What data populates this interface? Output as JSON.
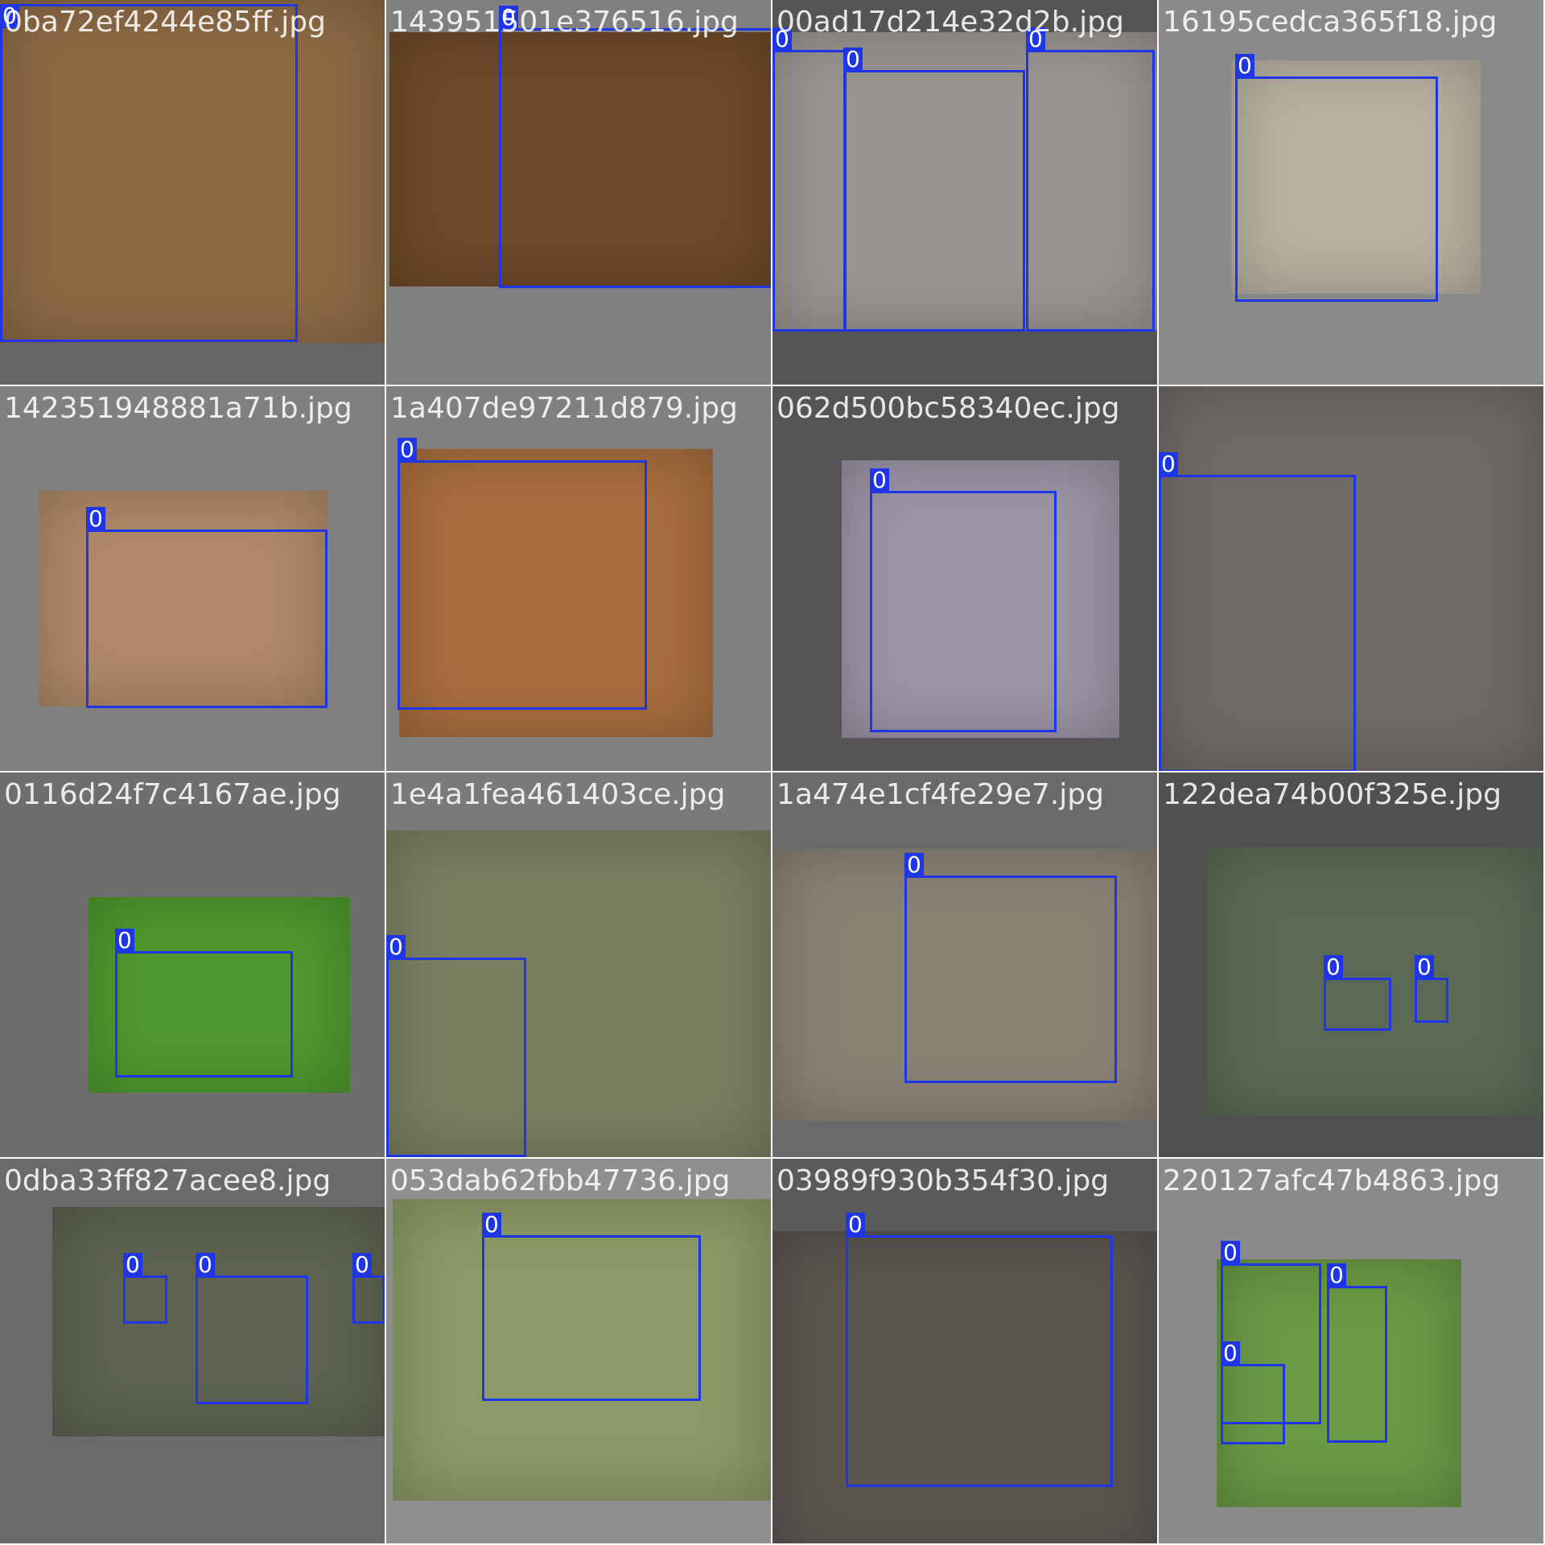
{
  "title": "",
  "colors": {
    "box": "#1f36e6",
    "label_text": "#ffffff"
  },
  "tiles": [
    {
      "filename": "0ba72ef4244e85ff.jpg",
      "background": "#666666",
      "photo_color": "#8c6a45",
      "boxes": [
        {
          "label": "0"
        }
      ]
    },
    {
      "filename": "143951501e376516.jpg",
      "background": "#808080",
      "photo_color": "#6f4a2a",
      "boxes": [
        {
          "label": "0"
        }
      ]
    },
    {
      "filename": "00ad17d214e32d2b.jpg",
      "background": "#555555",
      "photo_color": "#9a9590",
      "boxes": [
        {
          "label": "0"
        },
        {
          "label": "0"
        },
        {
          "label": "0"
        }
      ]
    },
    {
      "filename": "16195cedca365f18.jpg",
      "background": "#8a8a8a",
      "photo_color": "#b9b2a2",
      "boxes": [
        {
          "label": "0"
        }
      ]
    },
    {
      "filename": "142351948881a71b.jpg",
      "background": "#808080",
      "photo_color": "#b08a68",
      "boxes": [
        {
          "label": "0"
        }
      ]
    },
    {
      "filename": "1a407de97211d879.jpg",
      "background": "#808080",
      "photo_color": "#a86e3e",
      "boxes": [
        {
          "label": "0"
        }
      ]
    },
    {
      "filename": "062d500bc58340ec.jpg",
      "background": "#555555",
      "photo_color": "#9c95a6",
      "boxes": [
        {
          "label": "0"
        }
      ]
    },
    {
      "filename": "",
      "background": "#777777",
      "photo_color": "#6f6a66",
      "boxes": [
        {
          "label": "0"
        }
      ]
    },
    {
      "filename": "0116d24f7c4167ae.jpg",
      "background": "#6e6e6e",
      "photo_color": "#4f9a2e",
      "boxes": [
        {
          "label": "0"
        }
      ]
    },
    {
      "filename": "1e4a1fea461403ce.jpg",
      "background": "#7a7a7a",
      "photo_color": "#7a7f62",
      "boxes": [
        {
          "label": "0"
        }
      ]
    },
    {
      "filename": "1a474e1cf4fe29e7.jpg",
      "background": "#6a6a6a",
      "photo_color": "#8b8173",
      "boxes": [
        {
          "label": "0"
        }
      ]
    },
    {
      "filename": "122dea74b00f325e.jpg",
      "background": "#505050",
      "photo_color": "#5b6a55",
      "boxes": [
        {
          "label": "0"
        },
        {
          "label": "0"
        }
      ]
    },
    {
      "filename": "0dba33ff827acee8.jpg",
      "background": "#6a6a6a",
      "photo_color": "#5d6350",
      "boxes": [
        {
          "label": "0"
        },
        {
          "label": "0"
        },
        {
          "label": "0"
        }
      ]
    },
    {
      "filename": "053dab62fbb47736.jpg",
      "background": "#8f8f8f",
      "photo_color": "#8b9a66",
      "boxes": [
        {
          "label": "0"
        }
      ]
    },
    {
      "filename": "03989f930b354f30.jpg",
      "background": "#5a5a5a",
      "photo_color": "#5a554f",
      "boxes": [
        {
          "label": "0"
        }
      ]
    },
    {
      "filename": "220127afc47b4863.jpg",
      "background": "#8a8a8a",
      "photo_color": "#6a9a45",
      "boxes": [
        {
          "label": "0"
        },
        {
          "label": "0"
        },
        {
          "label": "0"
        }
      ]
    }
  ]
}
